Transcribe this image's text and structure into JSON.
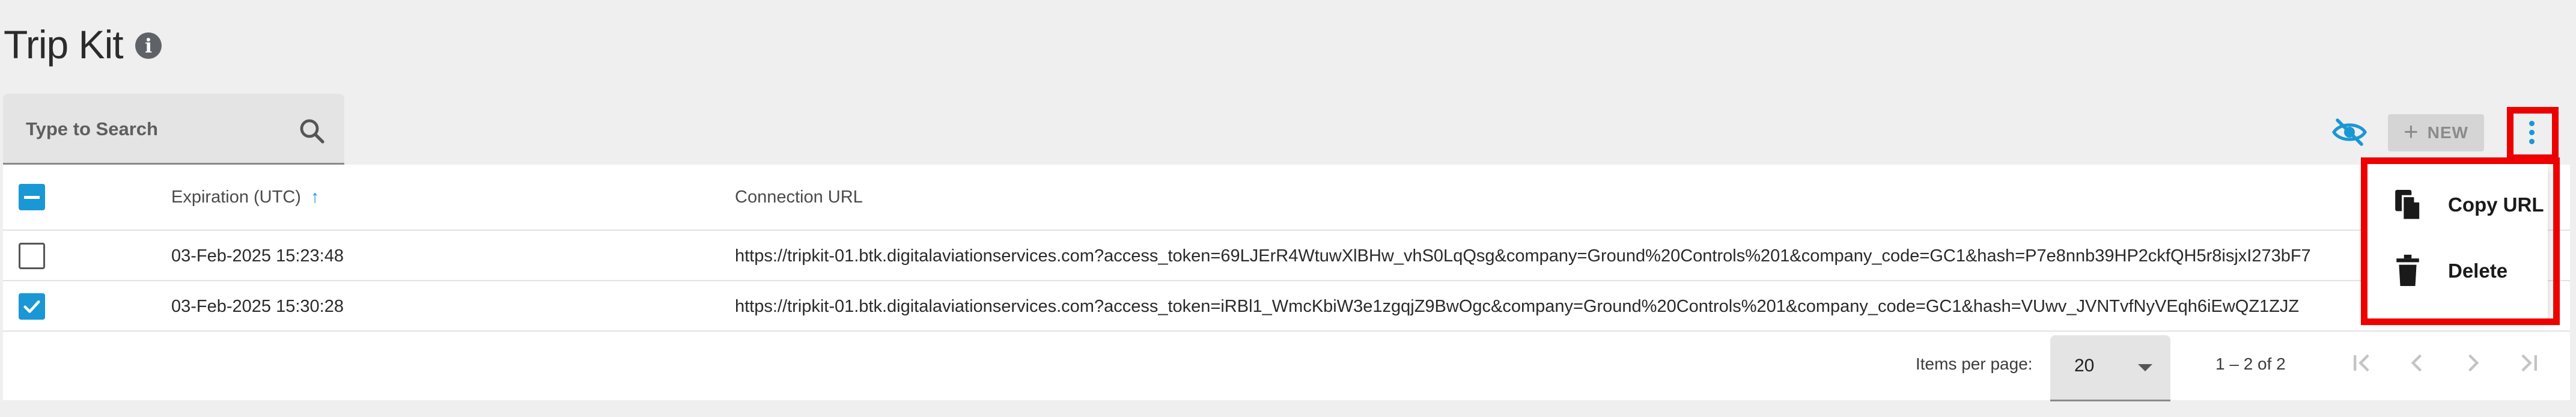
{
  "header": {
    "title": "Trip Kit",
    "info_icon": "info-icon"
  },
  "search": {
    "placeholder": "Type to Search",
    "value": "",
    "icon": "search-icon"
  },
  "toolbar": {
    "visibility_icon": "eye-slash-icon",
    "new_label": "NEW",
    "new_icon": "plus-icon",
    "more_icon": "kebab-vertical-icon"
  },
  "table": {
    "columns": {
      "expiration": "Expiration (UTC)",
      "url": "Connection URL"
    },
    "sort": {
      "column": "Expiration (UTC)",
      "direction": "ascending"
    },
    "header_checkbox_state": "indeterminate",
    "rows": [
      {
        "checked": false,
        "expiration": "03-Feb-2025 15:23:48",
        "url": "https://tripkit-01.btk.digitalaviationservices.com?access_token=69LJErR4WtuwXlBHw_vhS0LqQsg&company=Ground%20Controls%201&company_code=GC1&hash=P7e8nnb39HP2ckfQH5r8isjxI273bF7"
      },
      {
        "checked": true,
        "expiration": "03-Feb-2025 15:30:28",
        "url": "https://tripkit-01.btk.digitalaviationservices.com?access_token=iRBl1_WmcKbiW3e1zgqjZ9BwOgc&company=Ground%20Controls%201&company_code=GC1&hash=VUwv_JVNTvfNyVEqh6iEwQZ1ZJZ"
      }
    ]
  },
  "paginator": {
    "items_per_page_label": "Items per page:",
    "items_per_page": "20",
    "range": "1 – 2 of 2"
  },
  "context_menu": {
    "items": [
      {
        "label": "Copy URL",
        "icon": "copy-icon"
      },
      {
        "label": "Delete",
        "icon": "trash-icon"
      }
    ]
  },
  "colors": {
    "accent": "#1a97d5",
    "highlight": "#ee0000",
    "background": "#efefef"
  }
}
